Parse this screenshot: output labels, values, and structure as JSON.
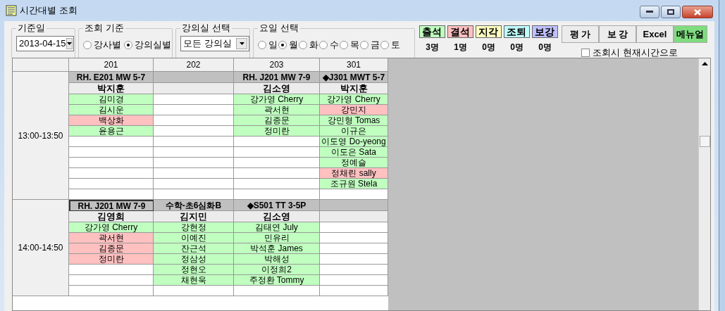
{
  "window": {
    "title": "시간대별 조회"
  },
  "date_group": {
    "label": "기준일",
    "value": "2013-04-15"
  },
  "criteria_group": {
    "label": "조회 기준",
    "options": [
      {
        "label": "강사별",
        "selected": false
      },
      {
        "label": "강의실별",
        "selected": true
      }
    ]
  },
  "room_group": {
    "label": "강의실 선택",
    "value": "모든 강의실"
  },
  "day_group": {
    "label": "요일 선택",
    "options": [
      {
        "label": "일",
        "selected": false
      },
      {
        "label": "월",
        "selected": true
      },
      {
        "label": "화",
        "selected": false
      },
      {
        "label": "수",
        "selected": false
      },
      {
        "label": "목",
        "selected": false
      },
      {
        "label": "금",
        "selected": false
      },
      {
        "label": "토",
        "selected": false
      }
    ]
  },
  "legend": [
    {
      "label": "출석",
      "color": "#c0ffc0",
      "count": "3명"
    },
    {
      "label": "결석",
      "color": "#ffc0c0",
      "count": "1명"
    },
    {
      "label": "지각",
      "color": "#ffffc0",
      "count": "0명"
    },
    {
      "label": "조퇴",
      "color": "#c0ffff",
      "count": "0명"
    },
    {
      "label": "보강",
      "color": "#c0c0ff",
      "count": "0명"
    }
  ],
  "buttons": [
    {
      "label": "평 가",
      "kind": "plain"
    },
    {
      "label": "보 강",
      "kind": "plain"
    },
    {
      "label": "Excel",
      "kind": "plain"
    },
    {
      "label": "메뉴얼",
      "kind": "accent"
    }
  ],
  "realtime_checkbox": {
    "label": "조회시 현재시간으로",
    "checked": false
  },
  "table": {
    "columns": [
      "201",
      "202",
      "203",
      "301"
    ],
    "blocks": [
      {
        "time": "13:00-13:50",
        "cells": [
          {
            "class": "RH. E201 MW 5-7",
            "selected": false,
            "teacher": "박지훈",
            "students": [
              {
                "name": "김미경",
                "color": "#c0ffc0"
              },
              {
                "name": "김시운",
                "color": "#c0ffc0"
              },
              {
                "name": "백상화",
                "color": "#ffc0c0"
              },
              {
                "name": "윤용근",
                "color": "#c0ffc0"
              }
            ]
          },
          {
            "selected": false
          },
          {
            "class": "RH. J201 MW 7-9",
            "selected": false,
            "teacher": "김소영",
            "students": [
              {
                "name": "강가영 Cherry",
                "color": "#c0ffc0"
              },
              {
                "name": "곽서현",
                "color": "#c0ffc0"
              },
              {
                "name": "김종문",
                "color": "#c0ffc0"
              },
              {
                "name": "정미란",
                "color": "#c0ffc0"
              }
            ]
          },
          {
            "class": "◆J301 MWT 5-7",
            "selected": false,
            "teacher": "박지훈",
            "students": [
              {
                "name": "강가영 Cherry",
                "color": "#c0ffc0"
              },
              {
                "name": "강민지",
                "color": "#ffc0c0"
              },
              {
                "name": "강민형 Tomas",
                "color": "#c0ffc0"
              },
              {
                "name": "이규은",
                "color": "#c0ffc0"
              },
              {
                "name": "이도영 Do-yeong",
                "color": "#c0ffc0"
              },
              {
                "name": "이도은 Sata",
                "color": "#c0ffc0"
              },
              {
                "name": "정예슬",
                "color": "#c0ffc0"
              },
              {
                "name": "정채린 sally",
                "color": "#ffc0c0"
              },
              {
                "name": "조규원 Stela",
                "color": "#c0ffc0"
              }
            ]
          }
        ]
      },
      {
        "time": "14:00-14:50",
        "cells": [
          {
            "class": "RH. J201 MW 7-9",
            "selected": true,
            "teacher": "김영희",
            "students": [
              {
                "name": "강가영 Cherry",
                "color": "#c0ffc0"
              },
              {
                "name": "곽서현",
                "color": "#ffc0c0"
              },
              {
                "name": "김종문",
                "color": "#ffc0c0"
              },
              {
                "name": "정미란",
                "color": "#ffc0c0"
              }
            ]
          },
          {
            "class": "수학-초6심화B",
            "selected": false,
            "teacher": "김지민",
            "students": [
              {
                "name": "강현정",
                "color": "#c0ffc0"
              },
              {
                "name": "이예진",
                "color": "#c0ffc0"
              },
              {
                "name": "잔근석",
                "color": "#c0ffc0"
              },
              {
                "name": "정삼성",
                "color": "#c0ffc0"
              },
              {
                "name": "정현오",
                "color": "#c0ffc0"
              },
              {
                "name": "채현욱",
                "color": "#c0ffc0"
              }
            ]
          },
          {
            "class": "◆S501 TT 3-5P",
            "selected": false,
            "teacher": "김소영",
            "students": [
              {
                "name": "김태연 July",
                "color": "#c0ffc0"
              },
              {
                "name": "민유리",
                "color": "#c0ffc0"
              },
              {
                "name": "박석훈 James",
                "color": "#c0ffc0"
              },
              {
                "name": "박해성",
                "color": "#c0ffc0"
              },
              {
                "name": "이정희2",
                "color": "#c0ffc0"
              },
              {
                "name": "주정환 Tommy",
                "color": "#c0ffc0"
              }
            ]
          },
          {
            "selected": false
          }
        ]
      }
    ]
  }
}
